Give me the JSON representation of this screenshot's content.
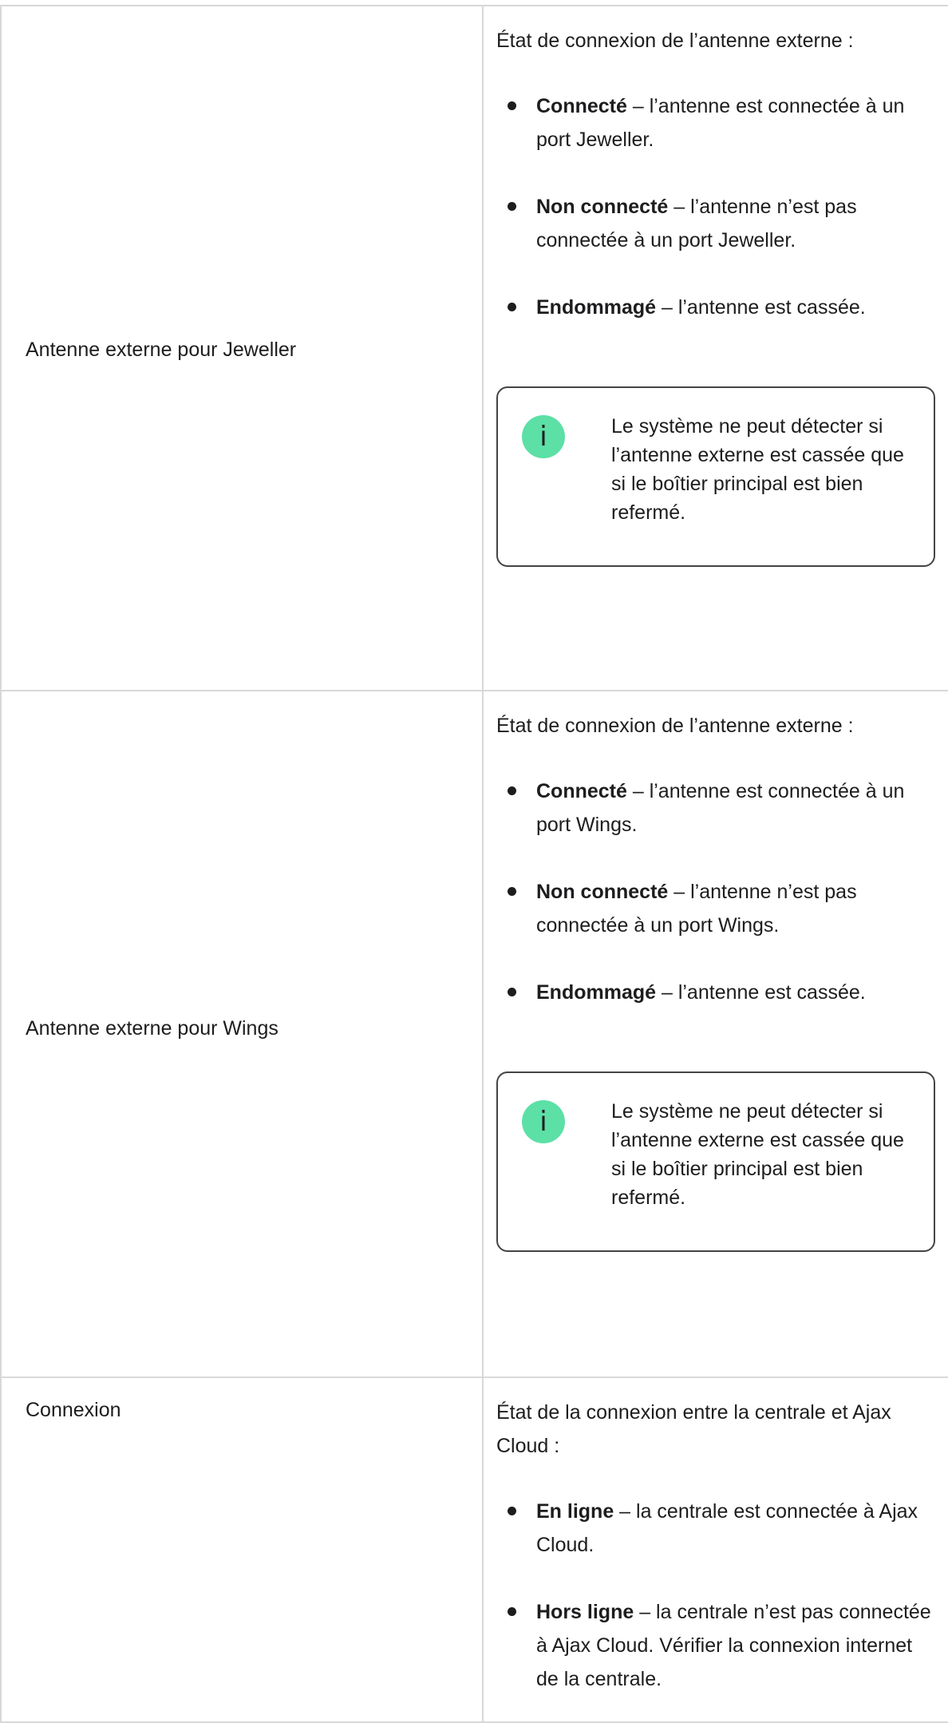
{
  "rows": [
    {
      "label": "Antenne externe pour Jeweller",
      "intro": "État de connexion de l’antenne externe :",
      "states": [
        {
          "term": "Connecté",
          "desc": " – l’antenne est connectée à un port Jeweller."
        },
        {
          "term": "Non connecté",
          "desc": " – l’antenne n’est pas connectée à un port Jeweller."
        },
        {
          "term": "Endommagé",
          "desc": " – l’antenne est cassée."
        }
      ],
      "note": {
        "icon": "i",
        "text": "Le système ne peut détecter si l’antenne externe est cassée que si le boîtier principal est bien refermé."
      }
    },
    {
      "label": "Antenne externe pour Wings",
      "intro": "État de connexion de l’antenne externe :",
      "states": [
        {
          "term": "Connecté",
          "desc": " – l’antenne est connectée à un port Wings."
        },
        {
          "term": "Non connecté",
          "desc": " – l’antenne n’est pas connectée à un port Wings."
        },
        {
          "term": "Endommagé",
          "desc": " – l’antenne est cassée."
        }
      ],
      "note": {
        "icon": "i",
        "text": "Le système ne peut détecter si l’antenne externe est cassée que si le boîtier principal est bien refermé."
      }
    },
    {
      "label": "Connexion",
      "intro": "État de la connexion entre la centrale et Ajax Cloud :",
      "states": [
        {
          "term": "En ligne",
          "desc": " – la centrale est connectée à Ajax Cloud."
        },
        {
          "term": "Hors ligne",
          "desc": " – la centrale n’est pas connectée à Ajax Cloud. Vérifier la connexion internet de la centrale."
        }
      ]
    }
  ],
  "colors": {
    "border": "#d8d8d8",
    "info_icon_bg": "#5ce0a6",
    "text": "#1d1d1f"
  },
  "icons": {
    "note_icon": "info-icon"
  }
}
